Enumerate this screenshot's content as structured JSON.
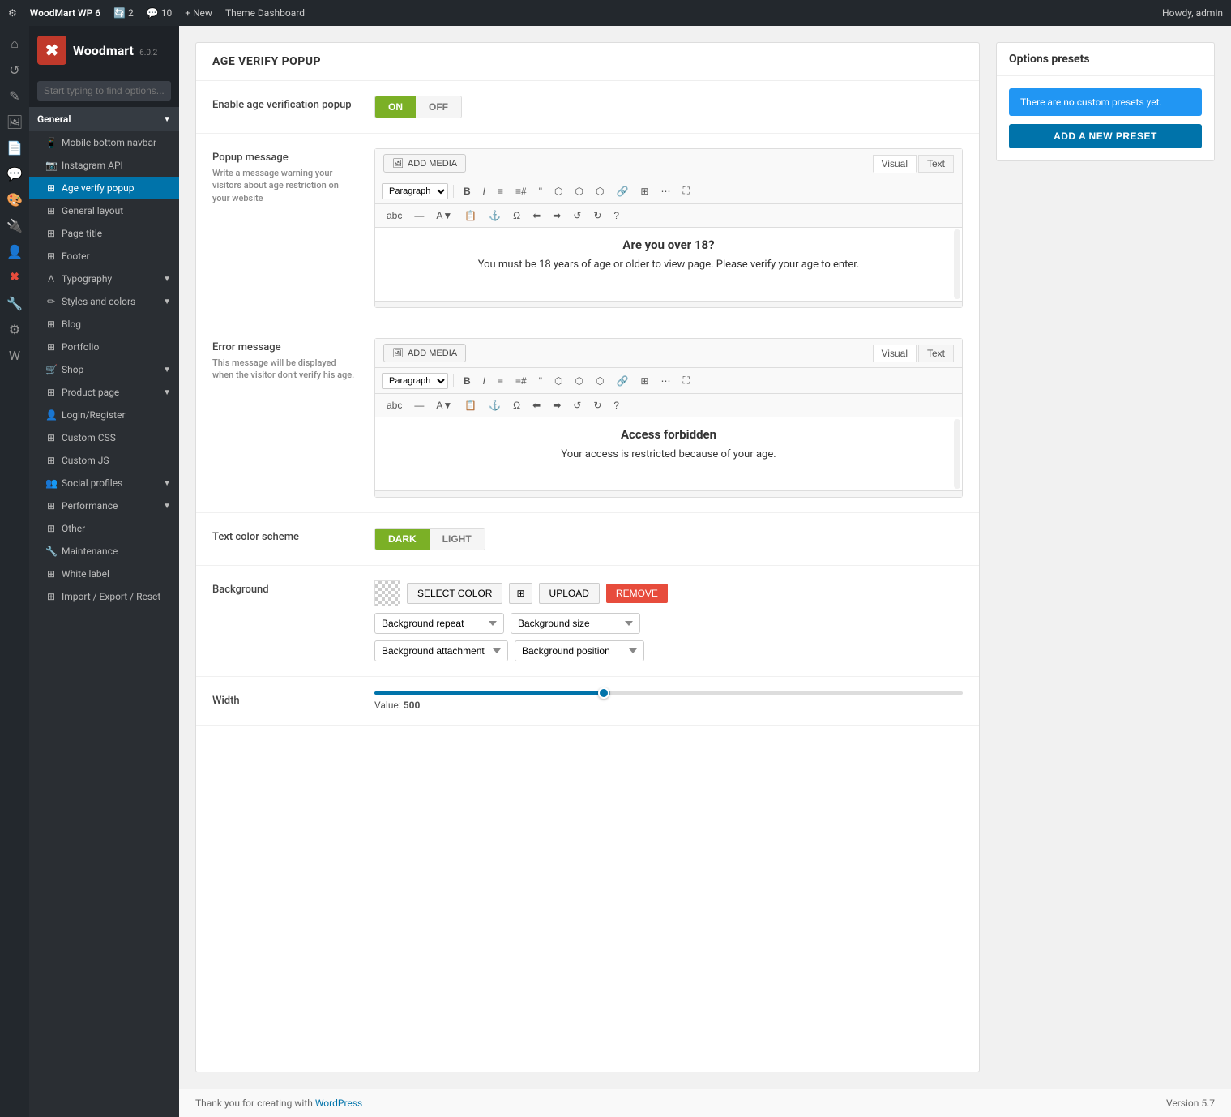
{
  "adminBar": {
    "siteName": "WoodMart WP 6",
    "updates": "2",
    "comments": "10",
    "newLabel": "+ New",
    "themeDashboard": "Theme Dashboard",
    "howdy": "Howdy, admin"
  },
  "woodmart": {
    "name": "Woodmart",
    "version": "6.0.2",
    "searchPlaceholder": "Start typing to find options..."
  },
  "sidebar": {
    "general": "General",
    "items": [
      {
        "label": "Mobile bottom navbar",
        "icon": "📱"
      },
      {
        "label": "Instagram API",
        "icon": "📷"
      },
      {
        "label": "Age verify popup",
        "icon": "🔞",
        "active": true
      },
      {
        "label": "General layout",
        "icon": "⊞"
      },
      {
        "label": "Page title",
        "icon": "⊞"
      },
      {
        "label": "Footer",
        "icon": "⊞"
      },
      {
        "label": "Typography",
        "icon": "A"
      },
      {
        "label": "Styles and colors",
        "icon": "✏"
      },
      {
        "label": "Blog",
        "icon": "⊞"
      },
      {
        "label": "Portfolio",
        "icon": "⊞"
      },
      {
        "label": "Shop",
        "icon": "🛒"
      },
      {
        "label": "Product page",
        "icon": "⊞"
      },
      {
        "label": "Login/Register",
        "icon": "👤"
      },
      {
        "label": "Custom CSS",
        "icon": "⊞"
      },
      {
        "label": "Custom JS",
        "icon": "⊞"
      },
      {
        "label": "Social profiles",
        "icon": "👥"
      },
      {
        "label": "Performance",
        "icon": "⊞"
      },
      {
        "label": "Other",
        "icon": "⊞"
      },
      {
        "label": "Maintenance",
        "icon": "🔧"
      },
      {
        "label": "White label",
        "icon": "⊞"
      },
      {
        "label": "Import / Export / Reset",
        "icon": "⊞"
      }
    ]
  },
  "pageTitle": "AGE VERIFY POPUP",
  "sections": {
    "enablePopup": {
      "label": "Enable age verification popup",
      "on": "ON",
      "off": "OFF"
    },
    "popupMessage": {
      "label": "Popup message",
      "desc": "Write a message warning your visitors about age restriction on your website",
      "addMedia": "ADD MEDIA",
      "visual": "Visual",
      "text": "Text",
      "paragraph": "Paragraph",
      "bodyTitle": "Are you over 18?",
      "bodyText": "You must be 18 years of age or older to view page. Please verify your age to enter."
    },
    "errorMessage": {
      "label": "Error message",
      "desc": "This message will be displayed when the visitor don't verify his age.",
      "addMedia": "ADD MEDIA",
      "visual": "Visual",
      "text": "Text",
      "paragraph": "Paragraph",
      "bodyTitle": "Access forbidden",
      "bodyText": "Your access is restricted because of your age."
    },
    "textColor": {
      "label": "Text color scheme",
      "dark": "DARK",
      "light": "LIGHT"
    },
    "background": {
      "label": "Background",
      "selectColor": "SELECT COLOR",
      "upload": "UPLOAD",
      "remove": "REMOVE",
      "repeatPlaceholder": "Background repeat",
      "sizePlaceholder": "Background size",
      "attachmentPlaceholder": "Background attachment",
      "positionPlaceholder": "Background position"
    },
    "width": {
      "label": "Width",
      "valueLabel": "Value:",
      "value": "500",
      "sliderPercent": 40
    }
  },
  "presets": {
    "title": "Options presets",
    "notice": "There are no custom presets yet.",
    "addButton": "ADD A NEW PRESET"
  },
  "footer": {
    "thankYou": "Thank you for creating with",
    "wordpress": "WordPress",
    "version": "Version 5.7"
  }
}
